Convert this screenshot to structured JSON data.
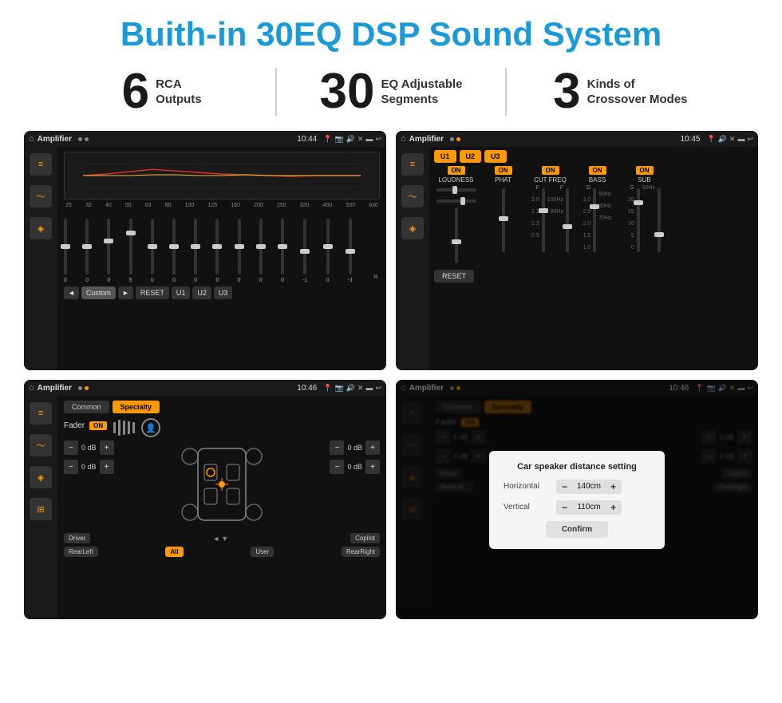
{
  "title": "Buith-in 30EQ DSP Sound System",
  "stats": [
    {
      "number": "6",
      "label": "RCA\nOutputs"
    },
    {
      "number": "30",
      "label": "EQ Adjustable\nSegments"
    },
    {
      "number": "3",
      "label": "Kinds of\nCrossover Modes"
    }
  ],
  "screens": [
    {
      "id": "screen1",
      "appName": "Amplifier",
      "time": "10:44",
      "type": "eq"
    },
    {
      "id": "screen2",
      "appName": "Amplifier",
      "time": "10:45",
      "type": "crossover"
    },
    {
      "id": "screen3",
      "appName": "Amplifier",
      "time": "10:46",
      "type": "fader"
    },
    {
      "id": "screen4",
      "appName": "Amplifier",
      "time": "10:46",
      "type": "dialog"
    }
  ],
  "eq": {
    "freqs": [
      "25",
      "32",
      "40",
      "50",
      "63",
      "80",
      "100",
      "125",
      "160",
      "200",
      "250",
      "320",
      "400",
      "500",
      "630"
    ],
    "values": [
      "0",
      "0",
      "0",
      "5",
      "0",
      "0",
      "0",
      "0",
      "0",
      "0",
      "0",
      "-1",
      "0",
      "-1"
    ],
    "preset": "Custom",
    "buttons": [
      "RESET",
      "U1",
      "U2",
      "U3"
    ]
  },
  "crossover": {
    "presets": [
      "U1",
      "U2",
      "U3"
    ],
    "controls": [
      {
        "label": "LOUDNESS",
        "on": true
      },
      {
        "label": "PHAT",
        "on": true
      },
      {
        "label": "CUT FREQ",
        "on": true
      },
      {
        "label": "BASS",
        "on": true
      },
      {
        "label": "SUB",
        "on": true
      }
    ],
    "reset": "RESET"
  },
  "fader": {
    "tabs": [
      "Common",
      "Specialty"
    ],
    "fader_label": "Fader",
    "on_label": "ON",
    "volumes": [
      "0 dB",
      "0 dB",
      "0 dB",
      "0 dB"
    ],
    "labels": [
      "Driver",
      "Copilot",
      "RearLeft",
      "All",
      "User",
      "RearRight"
    ]
  },
  "dialog": {
    "title": "Car speaker distance setting",
    "horizontal_label": "Horizontal",
    "horizontal_value": "140cm",
    "vertical_label": "Vertical",
    "vertical_value": "110cm",
    "confirm": "Confirm"
  }
}
